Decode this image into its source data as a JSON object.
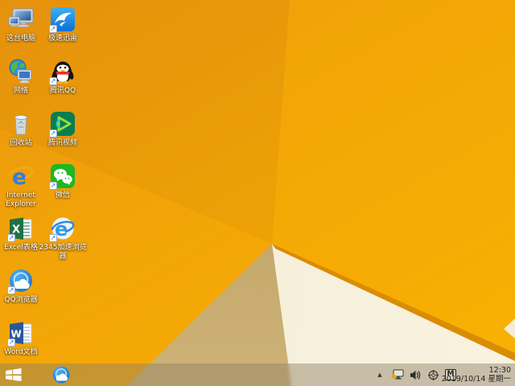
{
  "desktop": {
    "icons": [
      {
        "name": "this-pc",
        "label": "这台电脑"
      },
      {
        "name": "jisu-xunlei",
        "label": "极速迅雷"
      },
      {
        "name": "network",
        "label": "网络"
      },
      {
        "name": "tencent-qq",
        "label": "腾讯QQ"
      },
      {
        "name": "recycle-bin",
        "label": "回收站"
      },
      {
        "name": "tencent-video",
        "label": "腾讯视频"
      },
      {
        "name": "internet-explorer",
        "label": "Internet Explorer"
      },
      {
        "name": "wechat",
        "label": "微信"
      },
      {
        "name": "excel",
        "label": "Excel表格"
      },
      {
        "name": "browser-2345",
        "label": "2345加速浏览器"
      },
      {
        "name": "qq-browser",
        "label": "QQ浏览器"
      },
      {
        "name": "word",
        "label": "Word文档"
      }
    ]
  },
  "taskbar": {
    "tray_icons": [
      "hidden-icons-chevron",
      "network-status-warning",
      "volume",
      "utility",
      "ime-indicator"
    ],
    "clock": {
      "time": "12:30",
      "date": "2019/10/14 星期一"
    }
  },
  "colors": {
    "wallpaper_orange": "#f1a308",
    "wallpaper_fold_white": "#f6efda",
    "wallpaper_fold_shadow": "#c7aa6e",
    "wallpaper_fold_edge": "#d98c04",
    "taskbar_tint": "rgba(143,128,102,0.46)"
  }
}
